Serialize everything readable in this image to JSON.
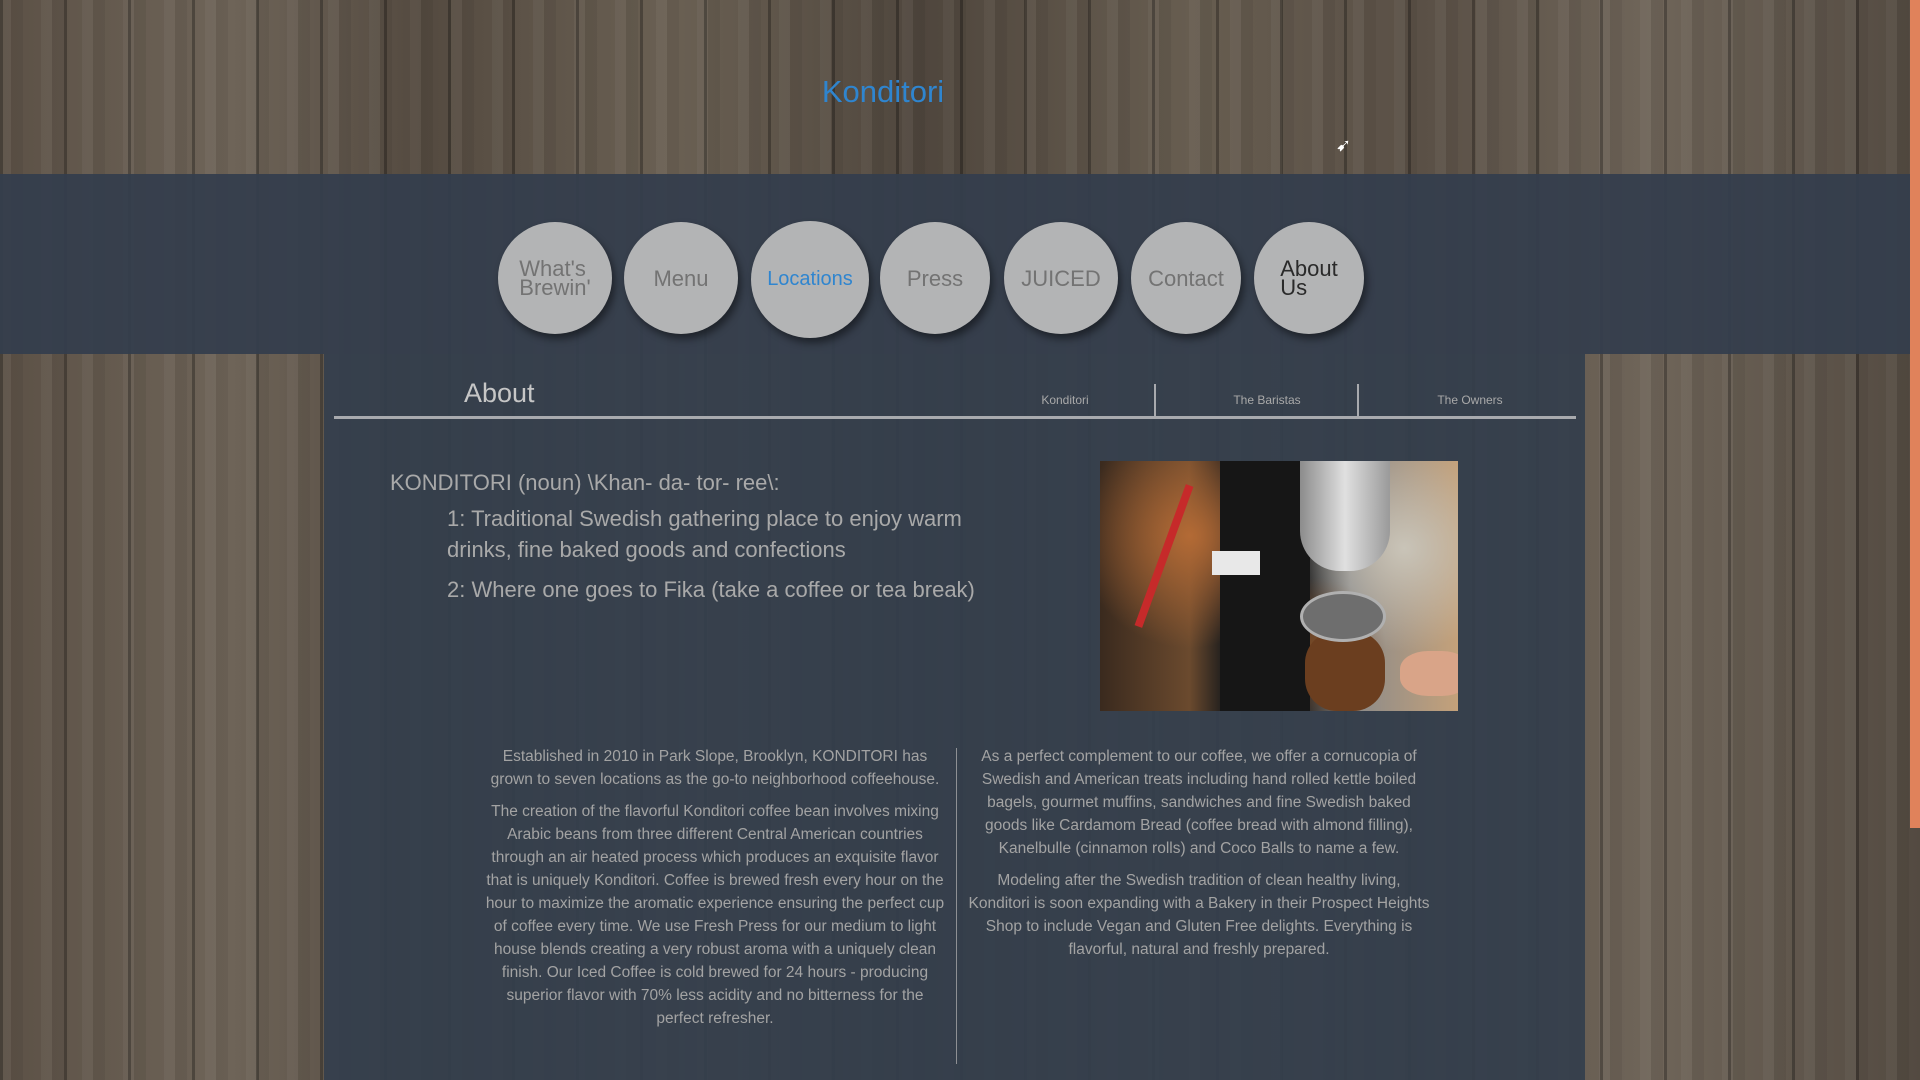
{
  "site": {
    "title": "Konditori"
  },
  "nav": {
    "items": [
      {
        "label_line1": "What's",
        "label_line2": "Brewin'"
      },
      {
        "label_line1": "Menu",
        "label_line2": ""
      },
      {
        "label_line1": "Locations",
        "label_line2": ""
      },
      {
        "label_line1": "Press",
        "label_line2": ""
      },
      {
        "label_line1": "JUICED",
        "label_line2": ""
      },
      {
        "label_line1": "Contact",
        "label_line2": ""
      },
      {
        "label_line1": "About",
        "label_line2": "Us"
      }
    ],
    "active": "Locations"
  },
  "about": {
    "heading": "About",
    "subnav": [
      "Konditori",
      "The Baristas",
      "The Owners"
    ],
    "definition_head": "KONDITORI (noun) \\Khan- da- tor- ree\\:",
    "definition_1_line1": "1: Traditional Swedish gathering place to enjoy warm",
    "definition_1_line2": "drinks, fine baked goods and confections",
    "definition_2": "2: Where one goes to Fika (take a coffee or tea break)"
  },
  "body": {
    "left_p1": "Established in 2010 in Park Slope, Brooklyn, KONDITORI has grown to seven locations as the go-to neighborhood coffeehouse.",
    "left_p2": "The creation of the flavorful Konditori coffee bean involves mixing Arabic beans from three different Central American countries through an air heated process which produces an exquisite flavor that is uniquely Konditori. Coffee is brewed fresh every hour on the hour to maximize the aromatic experience ensuring the perfect cup of coffee every time. We use Fresh Press for our medium to light house blends creating a very robust aroma with a uniquely clean finish. Our Iced Coffee is cold brewed for 24 hours - producing superior flavor with 70% less acidity and no bitterness for the perfect refresher.",
    "right_p1": "As a perfect complement to our coffee, we offer a cornucopia of Swedish and American treats including hand rolled kettle boiled bagels, gourmet muffins, sandwiches and fine Swedish baked goods like Cardamom Bread (coffee bread with almond filling), Kanelbulle (cinnamon rolls) and Coco Balls to name a few.",
    "right_p2": "Modeling after the Swedish tradition of clean healthy living, Konditori is soon expanding with a Bakery in their Prospect Heights Shop to include Vegan and Gluten Free delights. Everything is flavorful, natural and freshly prepared."
  },
  "colors": {
    "accent": "#2f85cf",
    "panel": "#343e4c",
    "button": "#b3b4b5",
    "edge": "#e0825b"
  }
}
